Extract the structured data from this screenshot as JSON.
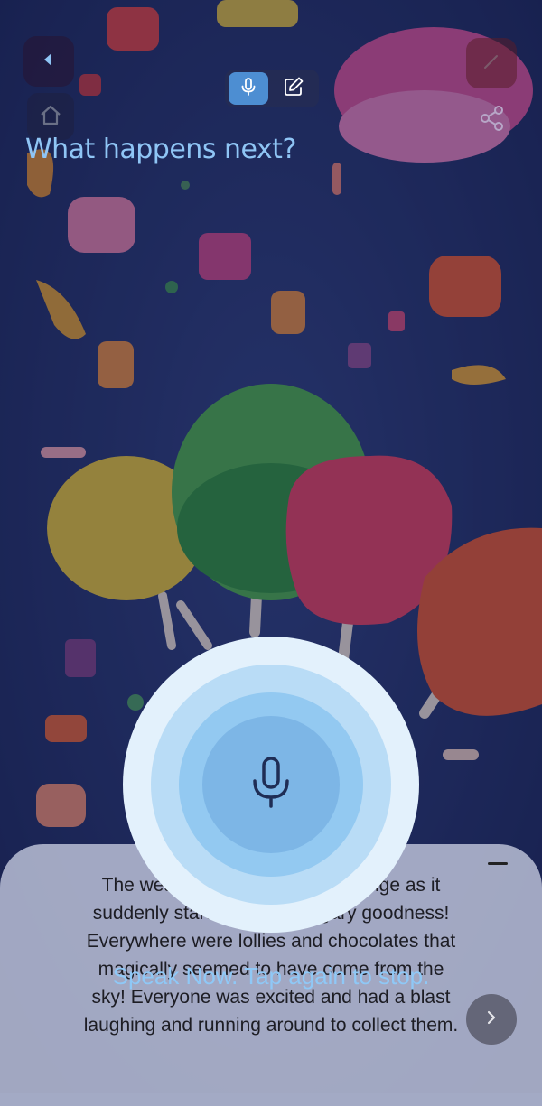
{
  "header": {
    "back_icon": "back-arrow-icon",
    "home_icon": "home-icon",
    "edit_icon": "pencil-icon",
    "share_icon": "share-icon"
  },
  "mode_toggle": {
    "options": [
      "voice",
      "text"
    ],
    "selected": "voice"
  },
  "prompt": "What happens next?",
  "story": {
    "text": "The weather took a strange change as it suddenly started raining sugary goodness! Everywhere were lollies and chocolates that magically seemed to have come from the sky! Everyone was excited and had a blast laughing and running around to collect them."
  },
  "recorder": {
    "status_text": "Speak Now. Tap again to stop.",
    "icon": "microphone-icon"
  },
  "colors": {
    "accent": "#4d8ed2",
    "prompt_text": "#8fc5f5",
    "mic_outer": "#e3f1fc",
    "mic_inner": "#7db6e6"
  }
}
